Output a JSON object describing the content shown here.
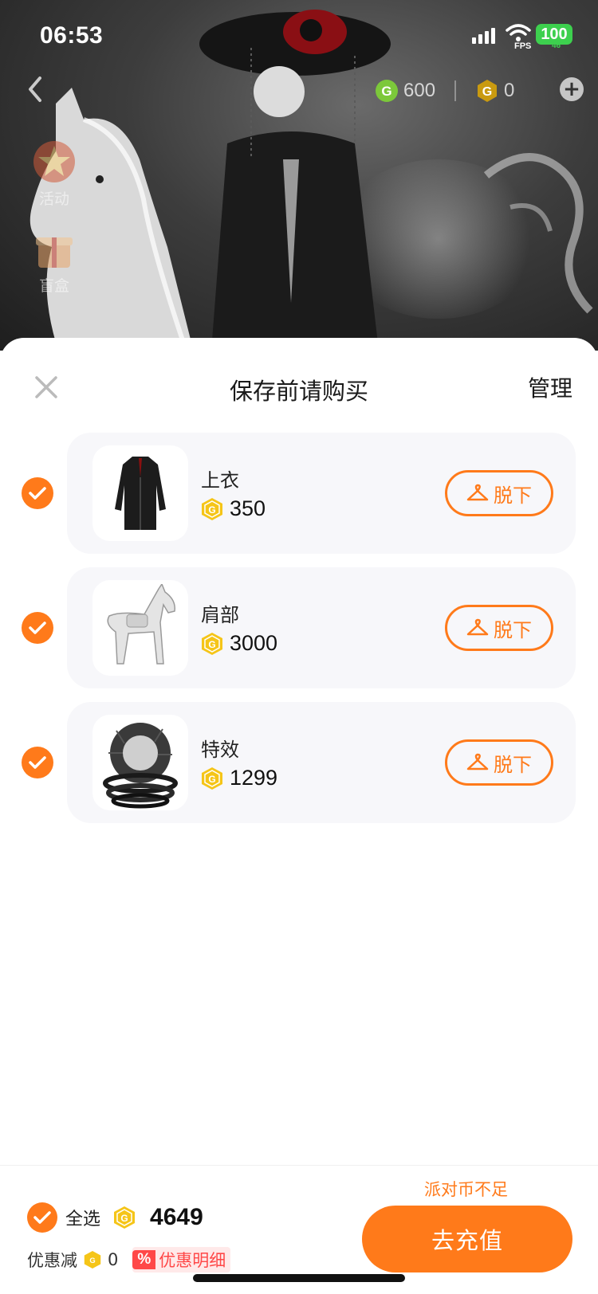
{
  "status_bar": {
    "time": "06:53",
    "fps_label": "FPS",
    "battery": "100",
    "battery_sub": "46"
  },
  "header": {
    "currencies": [
      {
        "icon": "green-coin-icon",
        "value": "600"
      },
      {
        "icon": "gold-coin-icon",
        "value": "0"
      }
    ],
    "side_menu": [
      {
        "icon": "star-event-icon",
        "label": "活动"
      },
      {
        "icon": "gift-box-icon",
        "label": "盲盒"
      }
    ]
  },
  "sheet": {
    "title": "保存前请购买",
    "manage_label": "管理",
    "items": [
      {
        "name": "上衣",
        "price": "350",
        "action_label": "脱下",
        "checked": true,
        "thumb": "black-coat"
      },
      {
        "name": "肩部",
        "price": "3000",
        "action_label": "脱下",
        "checked": true,
        "thumb": "white-horse"
      },
      {
        "name": "特效",
        "price": "1299",
        "action_label": "脱下",
        "checked": true,
        "thumb": "dark-vortex"
      }
    ]
  },
  "bottom_bar": {
    "insufficient_notice": "派对币不足",
    "select_all_label": "全选",
    "total": "4649",
    "discount_label": "优惠减",
    "discount_value": "0",
    "discount_badge": "%",
    "discount_detail_label": "优惠明细",
    "recharge_label": "去充值"
  },
  "colors": {
    "accent": "#ff7a1a",
    "discount_red": "#ff4848",
    "card_bg": "#f7f7fa",
    "coin_gold": "#f5c518"
  }
}
